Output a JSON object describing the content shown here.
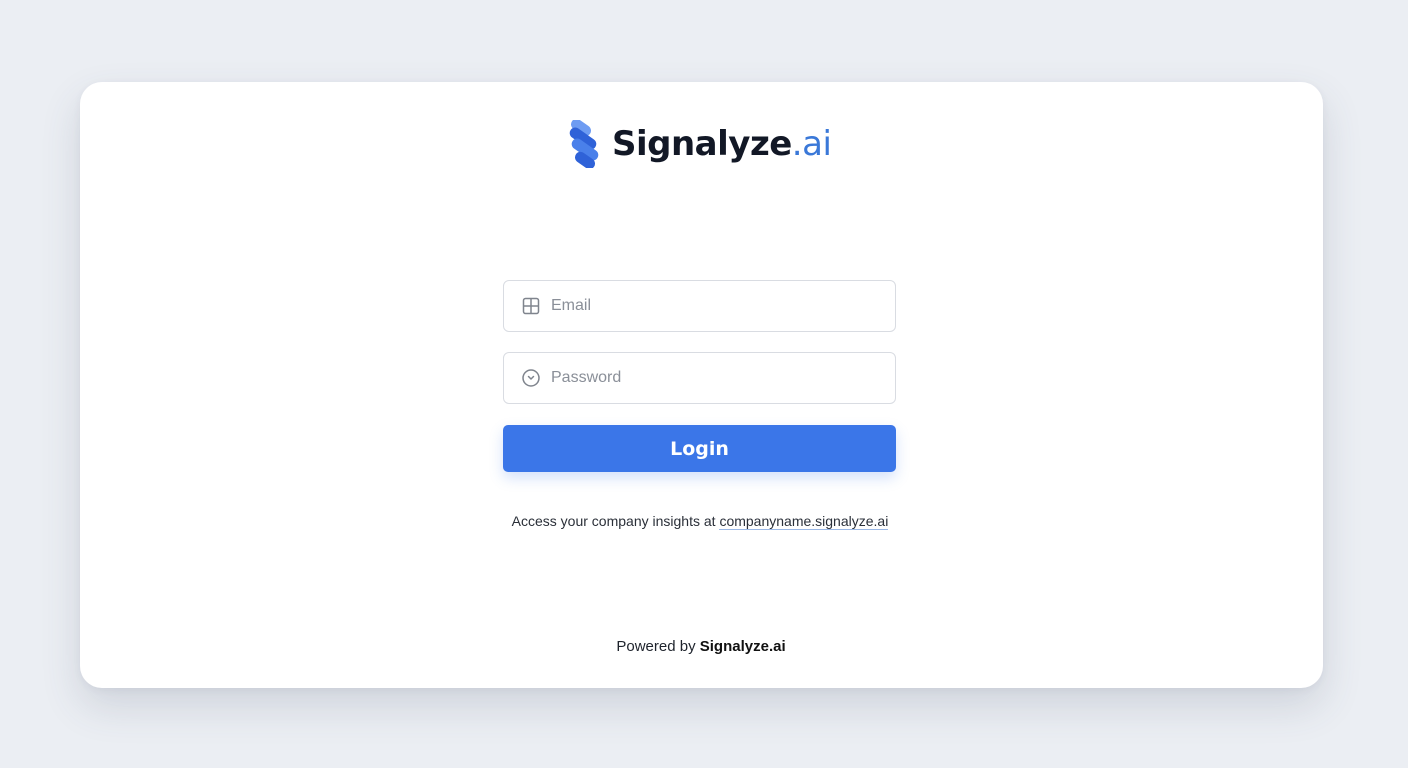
{
  "brand": {
    "logo_icon": "signalyze-s-logo-icon",
    "name": "Signalyze",
    "tld": ".ai",
    "colors": {
      "logo_light": "#6e9cf2",
      "logo_dark": "#2f62d8",
      "tld": "#3a78d8"
    }
  },
  "form": {
    "email": {
      "icon": "grid-icon",
      "placeholder": "Email",
      "value": ""
    },
    "password": {
      "icon": "clock-icon",
      "placeholder": "Password",
      "value": ""
    },
    "login_label": "Login",
    "accent": "#3b76e8"
  },
  "access_note": {
    "prefix": "Access your company insights at ",
    "link_text": "companyname.signalyze.ai"
  },
  "footer": {
    "prefix": "Powered by ",
    "brand": "Signalyze.ai"
  }
}
